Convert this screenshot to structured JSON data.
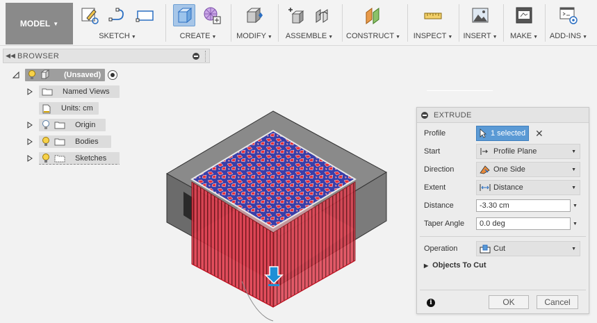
{
  "toolbar": {
    "workspace": "MODEL",
    "groups": [
      {
        "label": "SKETCH"
      },
      {
        "label": "CREATE"
      },
      {
        "label": "MODIFY"
      },
      {
        "label": "ASSEMBLE"
      },
      {
        "label": "CONSTRUCT"
      },
      {
        "label": "INSPECT"
      },
      {
        "label": "INSERT"
      },
      {
        "label": "MAKE"
      },
      {
        "label": "ADD-INS"
      }
    ]
  },
  "browser": {
    "title": "BROWSER",
    "root": "(Unsaved)",
    "items": [
      {
        "label": "Named Views"
      },
      {
        "label": "Units: cm"
      },
      {
        "label": "Origin"
      },
      {
        "label": "Bodies"
      },
      {
        "label": "Sketches"
      }
    ]
  },
  "extrude": {
    "title": "EXTRUDE",
    "rows": {
      "profile": {
        "label": "Profile",
        "value": "1 selected"
      },
      "start": {
        "label": "Start",
        "value": "Profile Plane"
      },
      "direction": {
        "label": "Direction",
        "value": "One Side"
      },
      "extent": {
        "label": "Extent",
        "value": "Distance"
      },
      "distance": {
        "label": "Distance",
        "value": "-3.30 cm"
      },
      "taper": {
        "label": "Taper Angle",
        "value": "0.0 deg"
      },
      "operation": {
        "label": "Operation",
        "value": "Cut"
      }
    },
    "objects_to_cut": "Objects To Cut",
    "ok": "OK",
    "cancel": "Cancel"
  },
  "colors": {
    "accent": "#5b9ad5",
    "cut_red": "#e8303a",
    "sketch_blue": "#3a3ea8",
    "body_gray": "#6f6f6f"
  }
}
